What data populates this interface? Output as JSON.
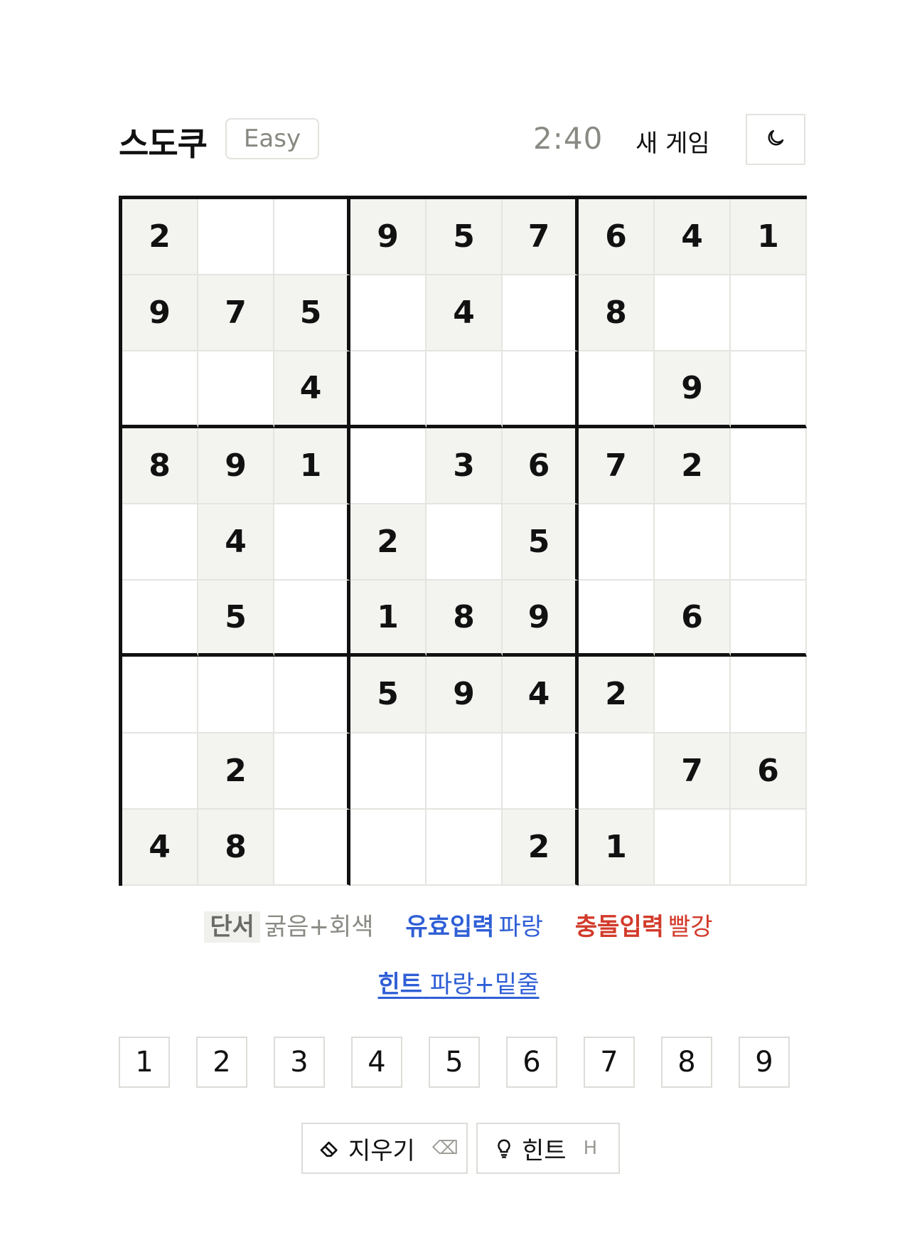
{
  "header": {
    "title": "스도쿠",
    "difficulty": "Easy",
    "timer": "2:40",
    "new_game": "새 게임",
    "theme_icon": "moon-icon"
  },
  "board": {
    "rows": [
      [
        "2",
        "",
        "",
        "9",
        "5",
        "7",
        "6",
        "4",
        "1"
      ],
      [
        "9",
        "7",
        "5",
        "",
        "4",
        "",
        "8",
        "",
        ""
      ],
      [
        "",
        "",
        "4",
        "",
        "",
        "",
        "",
        "9",
        ""
      ],
      [
        "8",
        "9",
        "1",
        "",
        "3",
        "6",
        "7",
        "2",
        ""
      ],
      [
        "",
        "4",
        "",
        "2",
        "",
        "5",
        "",
        "",
        ""
      ],
      [
        "",
        "5",
        "",
        "1",
        "8",
        "9",
        "",
        "6",
        ""
      ],
      [
        "",
        "",
        "",
        "5",
        "9",
        "4",
        "2",
        "",
        ""
      ],
      [
        "",
        "2",
        "",
        "",
        "",
        "",
        "",
        "7",
        "6"
      ],
      [
        "4",
        "8",
        "",
        "",
        "",
        "2",
        "1",
        "",
        ""
      ]
    ]
  },
  "legend": {
    "given_key": "단서",
    "given_val": "굵음+회색",
    "valid_key": "유효입력",
    "valid_val": "파랑",
    "conflict_key": "충돌입력",
    "conflict_val": "빨강",
    "hint_key": "힌트",
    "hint_val": "파랑+밑줄",
    "colors": {
      "valid": "#2f5fd6",
      "conflict": "#d23a2a",
      "given_bg": "#f3f3f0"
    }
  },
  "numpad": [
    "1",
    "2",
    "3",
    "4",
    "5",
    "6",
    "7",
    "8",
    "9"
  ],
  "actions": {
    "erase_label": "지우기",
    "erase_key": "⌫",
    "erase_icon": "eraser-icon",
    "hint_label": "힌트",
    "hint_key": "H",
    "hint_icon": "lightbulb-icon"
  }
}
